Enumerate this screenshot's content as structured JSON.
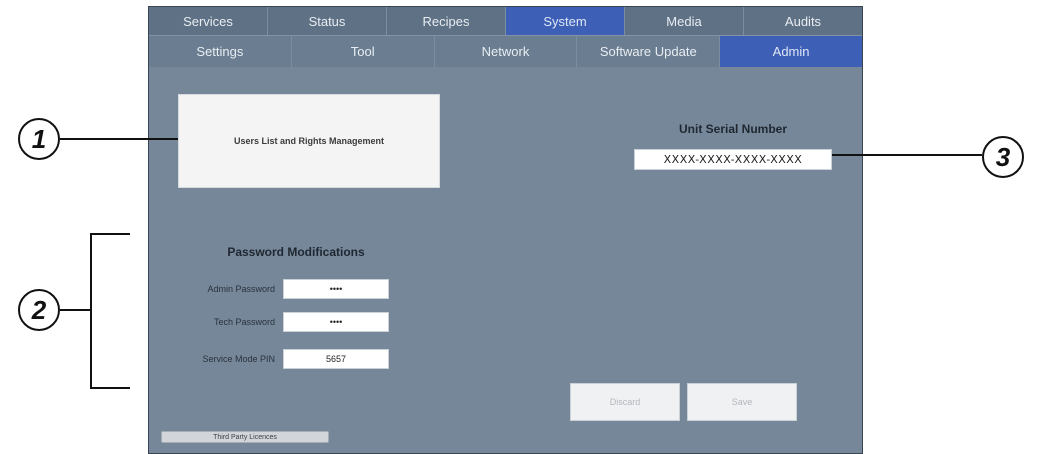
{
  "tabs_top": [
    {
      "label": "Services",
      "active": false
    },
    {
      "label": "Status",
      "active": false
    },
    {
      "label": "Recipes",
      "active": false
    },
    {
      "label": "System",
      "active": true
    },
    {
      "label": "Media",
      "active": false
    },
    {
      "label": "Audits",
      "active": false
    }
  ],
  "tabs_sub": [
    {
      "label": "Settings",
      "active": false
    },
    {
      "label": "Tool",
      "active": false
    },
    {
      "label": "Network",
      "active": false
    },
    {
      "label": "Software Update",
      "active": false
    },
    {
      "label": "Admin",
      "active": true
    }
  ],
  "users_button": {
    "label": "Users List and Rights Management"
  },
  "serial": {
    "title": "Unit Serial Number",
    "value": "XXXX-XXXX-XXXX-XXXX"
  },
  "passwords": {
    "title": "Password Modifications",
    "fields": [
      {
        "label": "Admin Password",
        "value": "••••"
      },
      {
        "label": "Tech Password",
        "value": "••••"
      },
      {
        "label": "Service Mode PIN",
        "value": "5657"
      }
    ]
  },
  "actions": {
    "discard": "Discard",
    "save": "Save"
  },
  "licence_button": "Third Party Licences",
  "callouts": {
    "one": "1",
    "two": "2",
    "three": "3"
  },
  "colors": {
    "active_tab": "#3d5fb6",
    "panel_bg": "#76879a"
  }
}
